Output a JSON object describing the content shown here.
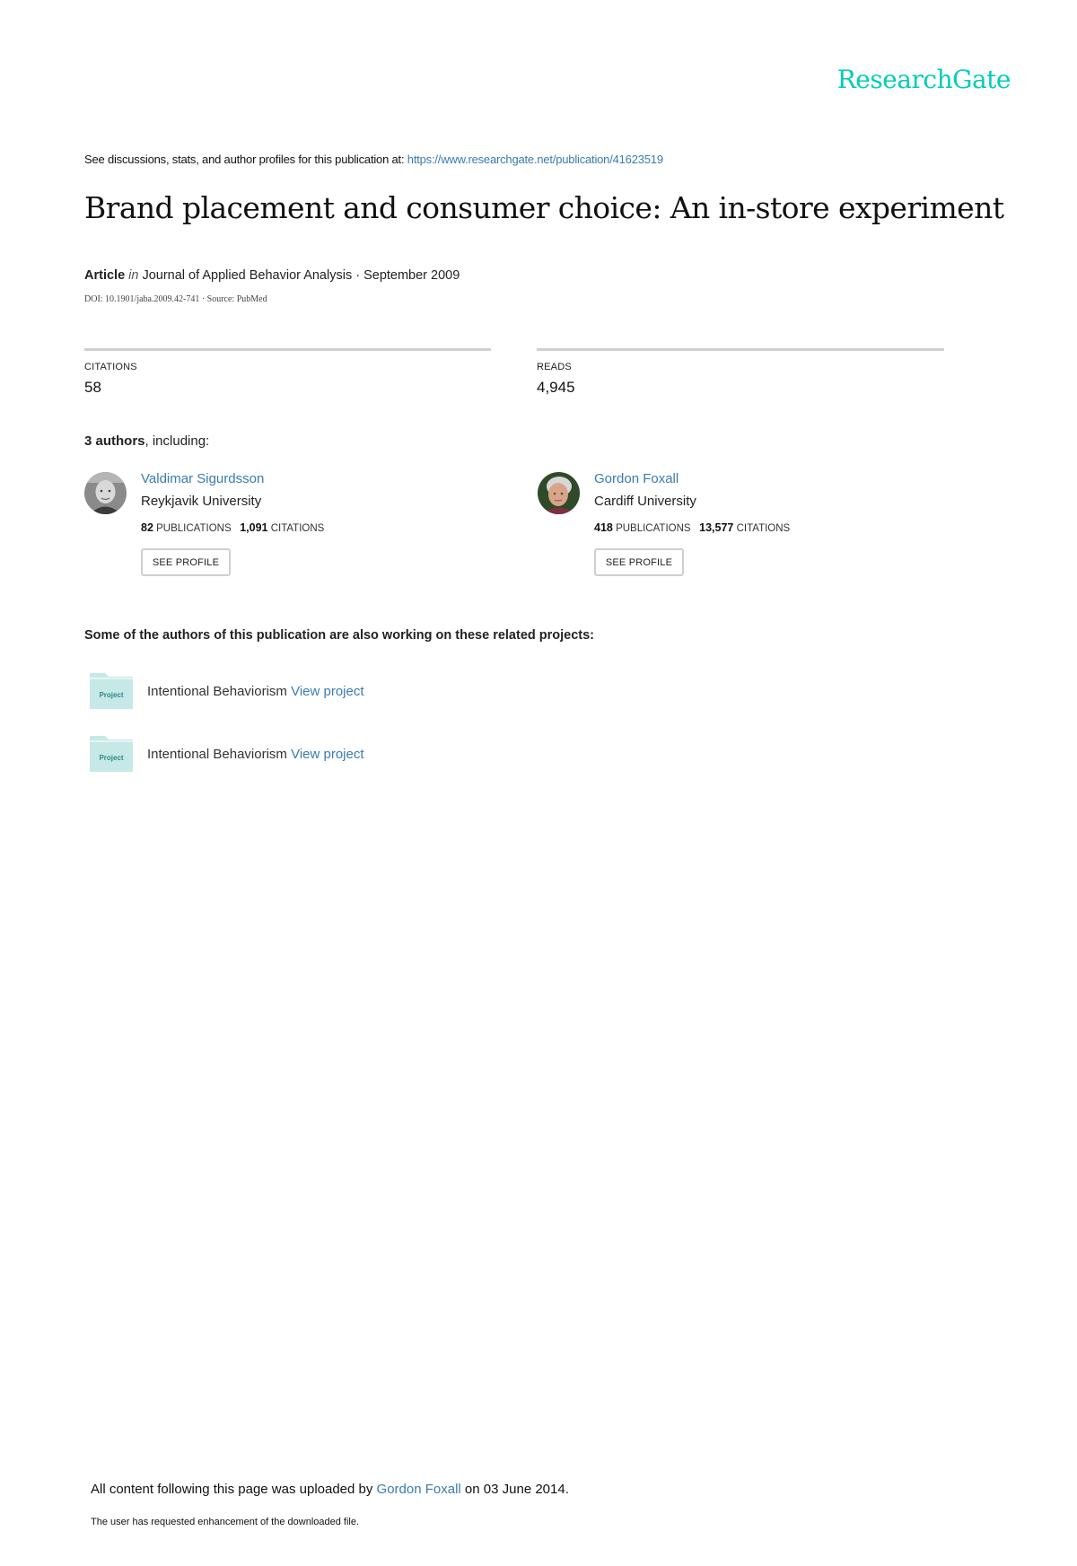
{
  "brand": {
    "logo": "ResearchGate",
    "color": "#00ccbb"
  },
  "header": {
    "see_text": "See discussions, stats, and author profiles for this publication at: ",
    "publication_url": "https://www.researchgate.net/publication/41623519"
  },
  "publication": {
    "title": "Brand placement and consumer choice: An in-store experiment",
    "type": "Article",
    "in_label": "in",
    "journal_date": "Journal of Applied Behavior Analysis · September 2009",
    "doi_source": "DOI: 10.1901/jaba.2009.42-741 · Source: PubMed"
  },
  "stats": {
    "citations_label": "CITATIONS",
    "citations_value": "58",
    "reads_label": "READS",
    "reads_value": "4,945"
  },
  "authors_section": {
    "count_text": "3 authors",
    "suffix": ", including:",
    "authors": [
      {
        "name": "Valdimar Sigurdsson",
        "affiliation": "Reykjavik University",
        "publications": "82",
        "publications_label": "PUBLICATIONS",
        "citations": "1,091",
        "citations_label": "CITATIONS",
        "button": "SEE PROFILE"
      },
      {
        "name": "Gordon Foxall",
        "affiliation": "Cardiff University",
        "publications": "418",
        "publications_label": "PUBLICATIONS",
        "citations": "13,577",
        "citations_label": "CITATIONS",
        "button": "SEE PROFILE"
      }
    ]
  },
  "related": {
    "heading": "Some of the authors of this publication are also working on these related projects:",
    "projects": [
      {
        "icon_label": "Project",
        "name": "Intentional Behaviorism",
        "link": "View project"
      },
      {
        "icon_label": "Project",
        "name": "Intentional Behaviorism",
        "link": "View project"
      }
    ]
  },
  "footer": {
    "upload_prefix": "All content following this page was uploaded by ",
    "uploader": "Gordon Foxall",
    "upload_suffix": " on 03 June 2014.",
    "note": "The user has requested enhancement of the downloaded file."
  }
}
